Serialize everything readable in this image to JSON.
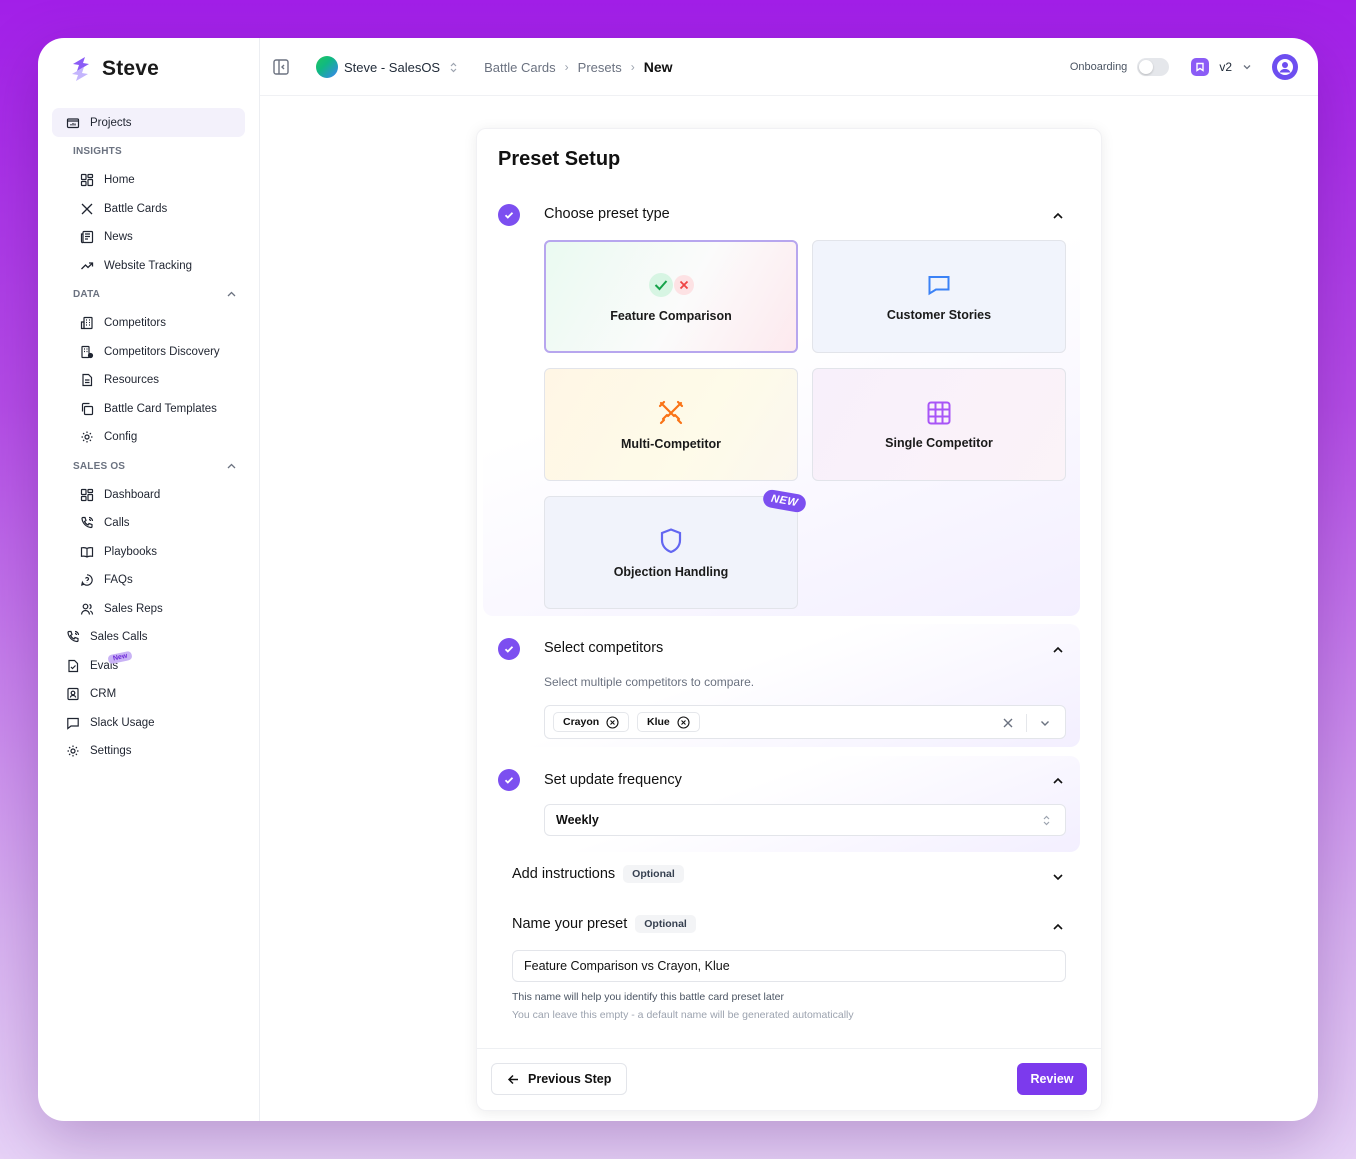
{
  "app": {
    "name": "Steve"
  },
  "sidebar": {
    "projects": "Projects",
    "sections": {
      "insights": "INSIGHTS",
      "data": "DATA",
      "sales_os": "SALES OS"
    },
    "insights": [
      {
        "label": "Home",
        "icon": "grid-icon"
      },
      {
        "label": "Battle Cards",
        "icon": "swords-icon"
      },
      {
        "label": "News",
        "icon": "newspaper-icon"
      },
      {
        "label": "Website Tracking",
        "icon": "trending-up-icon"
      }
    ],
    "data": [
      {
        "label": "Competitors",
        "icon": "building-icon"
      },
      {
        "label": "Competitors Discovery",
        "icon": "building-search-icon"
      },
      {
        "label": "Resources",
        "icon": "file-text-icon"
      },
      {
        "label": "Battle Card Templates",
        "icon": "copy-icon"
      },
      {
        "label": "Config",
        "icon": "gear-icon"
      }
    ],
    "sales_os": [
      {
        "label": "Dashboard",
        "icon": "grid-icon"
      },
      {
        "label": "Calls",
        "icon": "phone-icon"
      },
      {
        "label": "Playbooks",
        "icon": "book-icon"
      },
      {
        "label": "FAQs",
        "icon": "help-circle-icon"
      },
      {
        "label": "Sales Reps",
        "icon": "users-icon"
      }
    ],
    "bottom": [
      {
        "label": "Sales Calls",
        "icon": "phone-icon"
      },
      {
        "label": "Evals",
        "icon": "eval-icon",
        "tag": "New"
      },
      {
        "label": "CRM",
        "icon": "contact-icon"
      },
      {
        "label": "Slack Usage",
        "icon": "message-square-icon"
      },
      {
        "label": "Settings",
        "icon": "gear-icon"
      }
    ]
  },
  "topbar": {
    "workspace": "Steve - SalesOS",
    "breadcrumbs": [
      "Battle Cards",
      "Presets"
    ],
    "current": "New",
    "onboarding_label": "Onboarding",
    "version": "v2"
  },
  "preset": {
    "title": "Preset Setup",
    "step1": {
      "label": "Choose preset type",
      "tiles": [
        {
          "label": "Feature Comparison",
          "icon": "check-x-icon"
        },
        {
          "label": "Customer Stories",
          "icon": "message-square-icon"
        },
        {
          "label": "Multi-Competitor",
          "icon": "swords-icon"
        },
        {
          "label": "Single Competitor",
          "icon": "grid-3x3-icon"
        },
        {
          "label": "Objection Handling",
          "icon": "shield-icon",
          "badge": "NEW"
        }
      ],
      "selected": "Feature Comparison"
    },
    "step2": {
      "label": "Select competitors",
      "description": "Select multiple competitors to compare.",
      "chips": [
        "Crayon",
        "Klue"
      ]
    },
    "step3": {
      "label": "Set update frequency",
      "value": "Weekly"
    },
    "step4": {
      "label": "Add instructions",
      "optional": "Optional"
    },
    "step5": {
      "label": "Name your preset",
      "optional": "Optional",
      "value": "Feature Comparison vs Crayon, Klue",
      "hint1": "This name will help you identify this battle card preset later",
      "hint2": "You can leave this empty - a default name will be generated automatically"
    },
    "footer": {
      "previous": "Previous Step",
      "review": "Review"
    }
  },
  "colors": {
    "accent": "#7c3aed",
    "check": "#7c4ff0"
  }
}
